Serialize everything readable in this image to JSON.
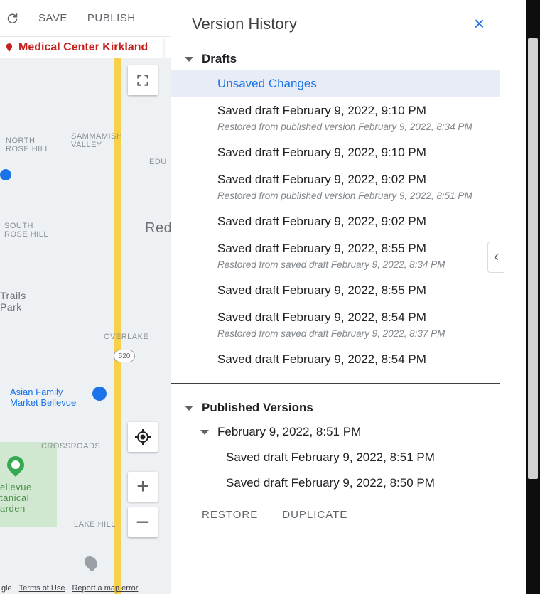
{
  "toolbar": {
    "save_label": "SAVE",
    "publish_label": "PUBLISH"
  },
  "location_strip": {
    "text": "Medical Center Kirkland"
  },
  "map": {
    "labels": {
      "north_rose_hill": "NORTH\nROSE HILL",
      "sammamish_valley": "SAMMAMISH\nVALLEY",
      "edu": "EDU",
      "south_rose_hill": "SOUTH\nROSE HILL",
      "redmond": "Redn",
      "trails_park": "Trails\nPark",
      "overlake": "OVERLAKE",
      "crossroads": "CROSSROADS",
      "lake_hill": "LAKE HILL",
      "asian_family": "Asian Family\nMarket Bellevue",
      "garden": "ellevue\ntanical\narden",
      "route_520": "520"
    },
    "footer": {
      "google": "gle",
      "terms": "Terms of Use",
      "report": "Report a map error"
    }
  },
  "version_history": {
    "title": "Version History",
    "drafts_header": "Drafts",
    "drafts": [
      {
        "label": "Unsaved Changes",
        "selected": true
      },
      {
        "label": "Saved draft February 9, 2022, 9:10 PM",
        "note": "Restored from published version February 9, 2022, 8:34 PM"
      },
      {
        "label": "Saved draft February 9, 2022, 9:10 PM"
      },
      {
        "label": "Saved draft February 9, 2022, 9:02 PM",
        "note": "Restored from published version February 9, 2022, 8:51 PM"
      },
      {
        "label": "Saved draft February 9, 2022, 9:02 PM"
      },
      {
        "label": "Saved draft February 9, 2022, 8:55 PM",
        "note": "Restored from saved draft February 9, 2022, 8:34 PM"
      },
      {
        "label": "Saved draft February 9, 2022, 8:55 PM"
      },
      {
        "label": "Saved draft February 9, 2022, 8:54 PM",
        "note": "Restored from saved draft February 9, 2022, 8:37 PM"
      },
      {
        "label": "Saved draft February 9, 2022, 8:54 PM"
      }
    ],
    "published_header": "Published Versions",
    "published": [
      {
        "label": "February 9, 2022, 8:51 PM",
        "children": [
          "Saved draft February 9, 2022, 8:51 PM",
          "Saved draft February 9, 2022, 8:50 PM"
        ]
      }
    ],
    "actions": {
      "restore": "RESTORE",
      "duplicate": "DUPLICATE"
    }
  }
}
